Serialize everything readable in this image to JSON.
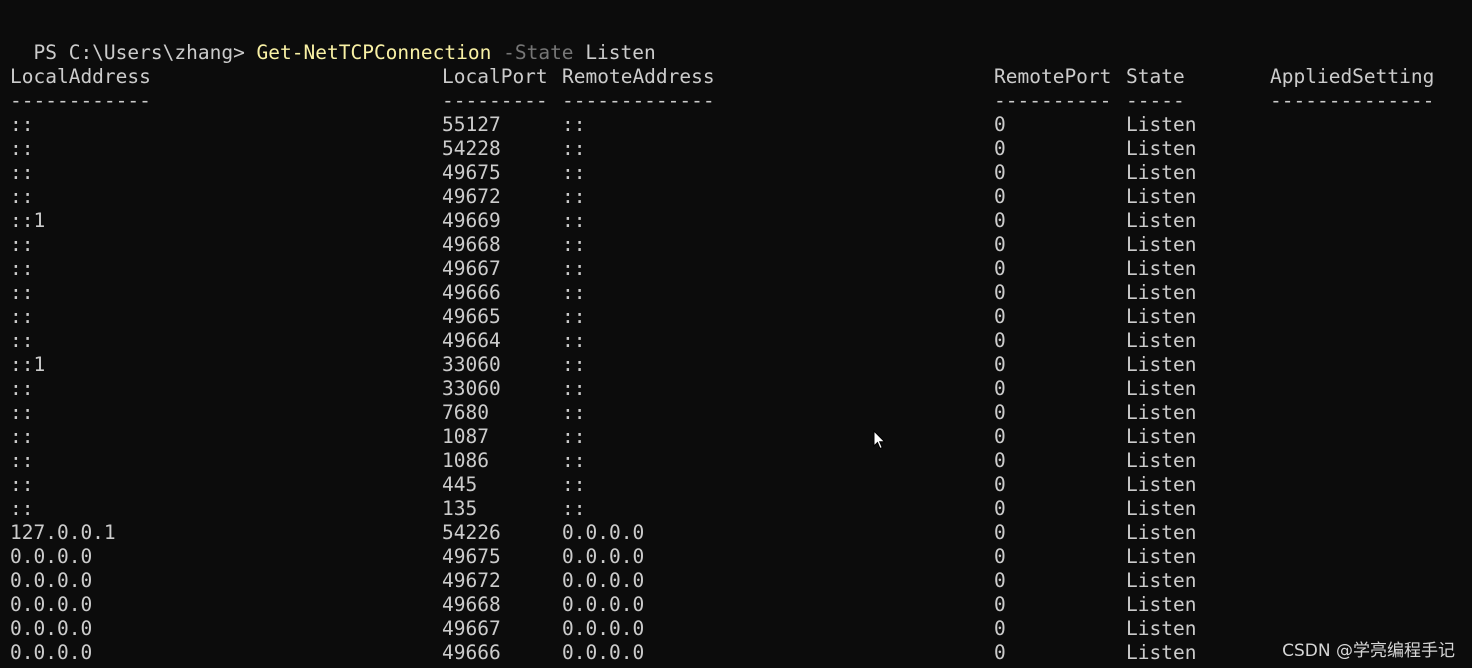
{
  "prompt": {
    "path": "PS C:\\Users\\zhang> ",
    "command": "Get-NetTCPConnection",
    "parameter": "-State",
    "argument": "Listen"
  },
  "table": {
    "columns": [
      "LocalAddress",
      "LocalPort",
      "RemoteAddress",
      "RemotePort",
      "State",
      "AppliedSetting"
    ],
    "separators": [
      "------------",
      "---------",
      "-------------",
      "----------",
      "-----",
      "--------------"
    ],
    "rows": [
      [
        "::",
        "55127",
        "::",
        "0",
        "Listen",
        ""
      ],
      [
        "::",
        "54228",
        "::",
        "0",
        "Listen",
        ""
      ],
      [
        "::",
        "49675",
        "::",
        "0",
        "Listen",
        ""
      ],
      [
        "::",
        "49672",
        "::",
        "0",
        "Listen",
        ""
      ],
      [
        "::1",
        "49669",
        "::",
        "0",
        "Listen",
        ""
      ],
      [
        "::",
        "49668",
        "::",
        "0",
        "Listen",
        ""
      ],
      [
        "::",
        "49667",
        "::",
        "0",
        "Listen",
        ""
      ],
      [
        "::",
        "49666",
        "::",
        "0",
        "Listen",
        ""
      ],
      [
        "::",
        "49665",
        "::",
        "0",
        "Listen",
        ""
      ],
      [
        "::",
        "49664",
        "::",
        "0",
        "Listen",
        ""
      ],
      [
        "::1",
        "33060",
        "::",
        "0",
        "Listen",
        ""
      ],
      [
        "::",
        "33060",
        "::",
        "0",
        "Listen",
        ""
      ],
      [
        "::",
        "7680",
        "::",
        "0",
        "Listen",
        ""
      ],
      [
        "::",
        "1087",
        "::",
        "0",
        "Listen",
        ""
      ],
      [
        "::",
        "1086",
        "::",
        "0",
        "Listen",
        ""
      ],
      [
        "::",
        "445",
        "::",
        "0",
        "Listen",
        ""
      ],
      [
        "::",
        "135",
        "::",
        "0",
        "Listen",
        ""
      ],
      [
        "127.0.0.1",
        "54226",
        "0.0.0.0",
        "0",
        "Listen",
        ""
      ],
      [
        "0.0.0.0",
        "49675",
        "0.0.0.0",
        "0",
        "Listen",
        ""
      ],
      [
        "0.0.0.0",
        "49672",
        "0.0.0.0",
        "0",
        "Listen",
        ""
      ],
      [
        "0.0.0.0",
        "49668",
        "0.0.0.0",
        "0",
        "Listen",
        ""
      ],
      [
        "0.0.0.0",
        "49667",
        "0.0.0.0",
        "0",
        "Listen",
        ""
      ],
      [
        "0.0.0.0",
        "49666",
        "0.0.0.0",
        "0",
        "Listen",
        ""
      ]
    ]
  },
  "watermark": "CSDN @学亮编程手记",
  "colors": {
    "background": "#0c0c0c",
    "text": "#cccccc",
    "command": "#f9f1a5",
    "parameter": "#767676"
  }
}
